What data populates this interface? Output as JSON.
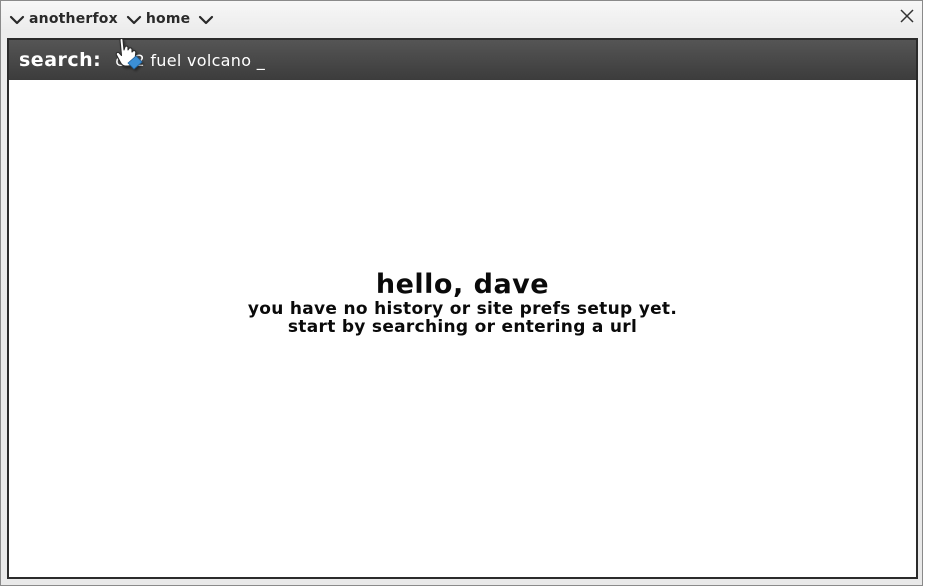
{
  "titlebar": {
    "crumbs": [
      {
        "label": "anotherfox"
      },
      {
        "label": "home"
      }
    ],
    "close_icon": "close-icon"
  },
  "search": {
    "label": "search:",
    "value": "co2 fuel volcano _"
  },
  "greeting": {
    "title": "hello, dave",
    "line1": "you have no history or site prefs setup yet.",
    "line2": "start by searching or entering a url"
  },
  "colors": {
    "searchbar_bg": "#474747",
    "border": "#2b2b2b",
    "cursor_accent": "#3a8fd6"
  }
}
